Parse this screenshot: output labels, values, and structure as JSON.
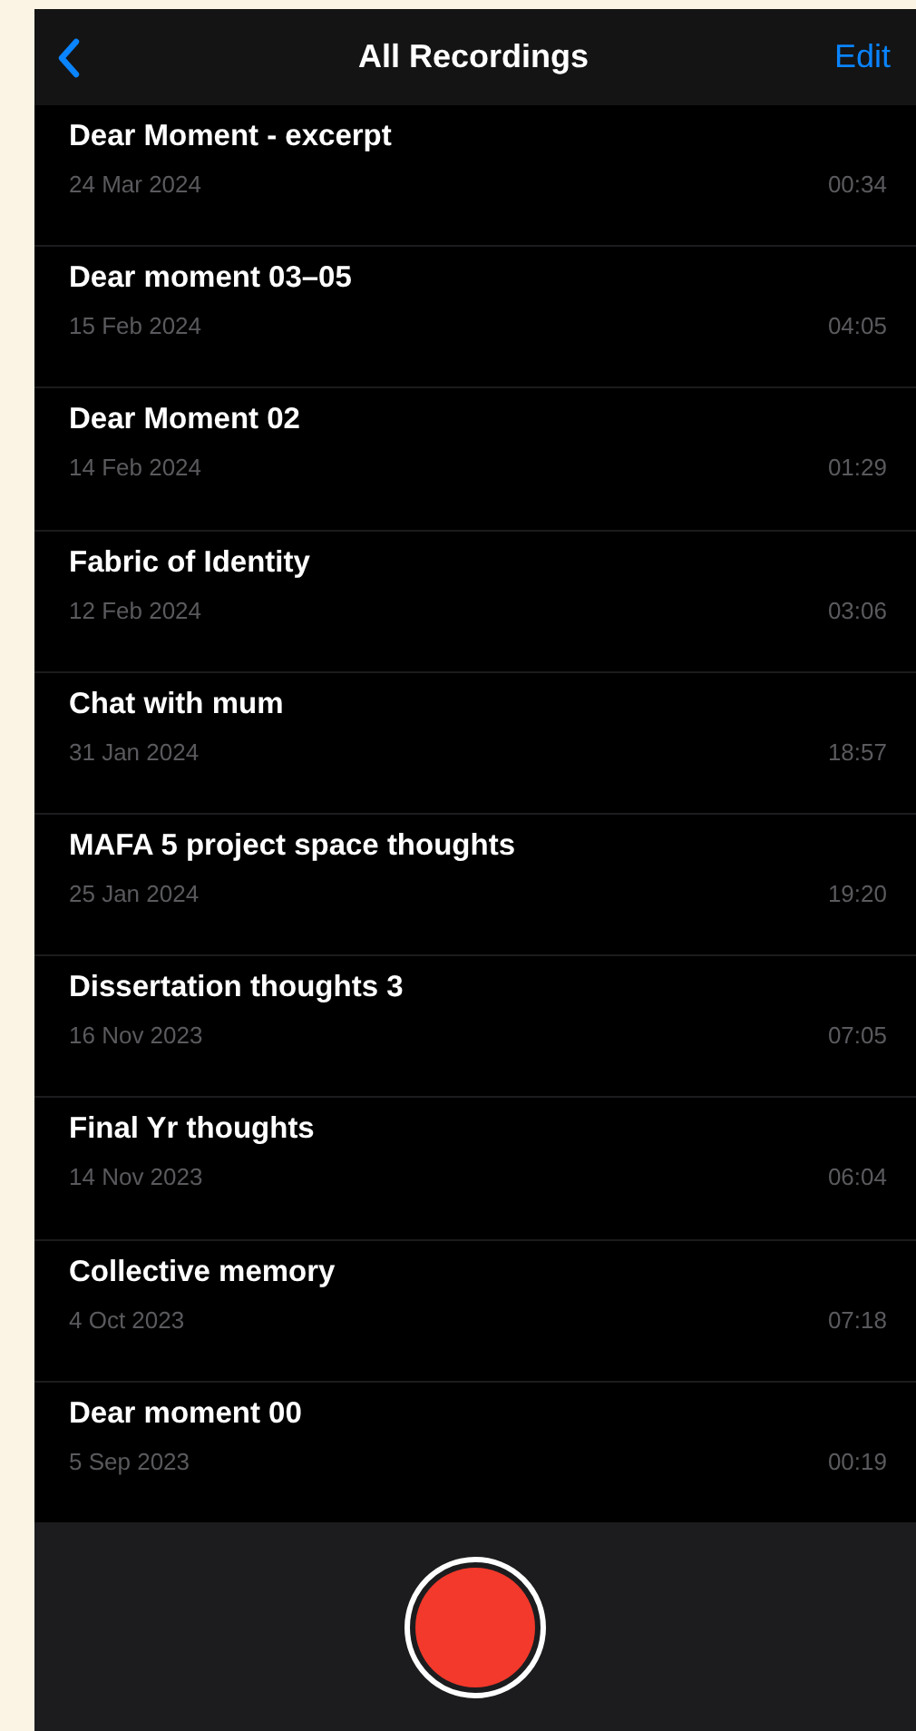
{
  "nav_bar": {
    "title": "All Recordings",
    "action": "Edit"
  },
  "recordings": [
    {
      "title": "Dear Moment - excerpt",
      "date": "24 Mar 2024",
      "duration": "00:34"
    },
    {
      "title": "Dear moment 03–05",
      "date": "15 Feb 2024",
      "duration": "04:05"
    },
    {
      "title": "Dear Moment 02",
      "date": "14 Feb 2024",
      "duration": "01:29"
    },
    {
      "title": "Fabric of Identity",
      "date": "12 Feb 2024",
      "duration": "03:06"
    },
    {
      "title": "Chat with mum",
      "date": "31 Jan 2024",
      "duration": "18:57"
    },
    {
      "title": "MAFA 5 project space thoughts",
      "date": "25 Jan 2024",
      "duration": "19:20"
    },
    {
      "title": "Dissertation thoughts 3",
      "date": "16 Nov 2023",
      "duration": "07:05"
    },
    {
      "title": "Final Yr thoughts",
      "date": "14 Nov 2023",
      "duration": "06:04"
    },
    {
      "title": "Collective memory",
      "date": "4 Oct 2023",
      "duration": "07:18"
    },
    {
      "title": "Dear moment 00",
      "date": "5 Sep 2023",
      "duration": "00:19"
    }
  ]
}
